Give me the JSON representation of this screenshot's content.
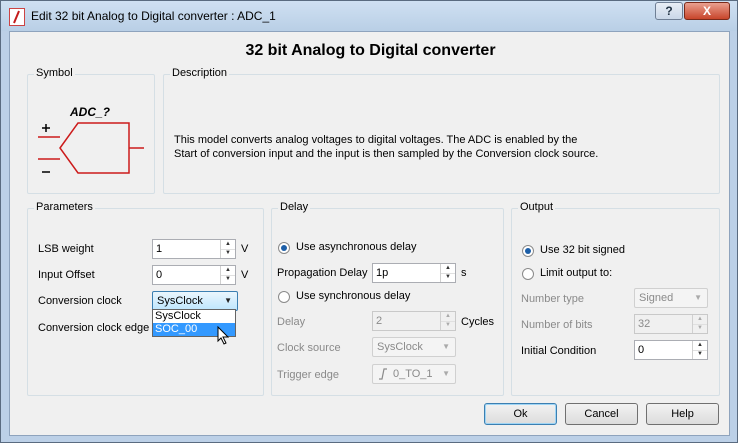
{
  "window": {
    "title": "Edit 32 bit Analog to Digital converter : ADC_1",
    "help_btn": "?",
    "close_btn": "X"
  },
  "heading": "32 bit Analog to Digital converter",
  "symbol": {
    "group_title": "Symbol",
    "component_label": "ADC_?",
    "plus": "+",
    "minus": "–"
  },
  "description": {
    "group_title": "Description",
    "line1": "This model converts analog voltages to digital voltages. The ADC is enabled by the",
    "line2": "Start of conversion input and the input is then sampled by the Conversion clock source."
  },
  "parameters": {
    "group_title": "Parameters",
    "lsb_weight_label": "LSB weight",
    "lsb_weight_value": "1",
    "lsb_weight_unit": "V",
    "input_offset_label": "Input Offset",
    "input_offset_value": "0",
    "input_offset_unit": "V",
    "conversion_clock_label": "Conversion clock",
    "conversion_clock_value": "SysClock",
    "conversion_clock_edge_label": "Conversion clock edge",
    "dropdown_options": [
      "SysClock",
      "SOC_00"
    ]
  },
  "delay": {
    "group_title": "Delay",
    "async_label": "Use asynchronous delay",
    "prop_delay_label": "Propagation Delay",
    "prop_delay_value": "1p",
    "prop_delay_unit": "s",
    "sync_label": "Use synchronous delay",
    "delay_label": "Delay",
    "delay_value": "2",
    "delay_unit": "Cycles",
    "clock_source_label": "Clock source",
    "clock_source_value": "SysClock",
    "trigger_edge_label": "Trigger edge",
    "trigger_edge_value": "0_TO_1"
  },
  "output": {
    "group_title": "Output",
    "use32_label": "Use 32 bit signed",
    "limit_label": "Limit output to:",
    "number_type_label": "Number type",
    "number_type_value": "Signed",
    "number_of_bits_label": "Number of bits",
    "number_of_bits_value": "32",
    "initial_condition_label": "Initial Condition",
    "initial_condition_value": "0"
  },
  "buttons": {
    "ok": "Ok",
    "cancel": "Cancel",
    "help": "Help"
  },
  "colors": {
    "symbol_red": "#cc1b1b",
    "selection_blue": "#3399ff"
  }
}
